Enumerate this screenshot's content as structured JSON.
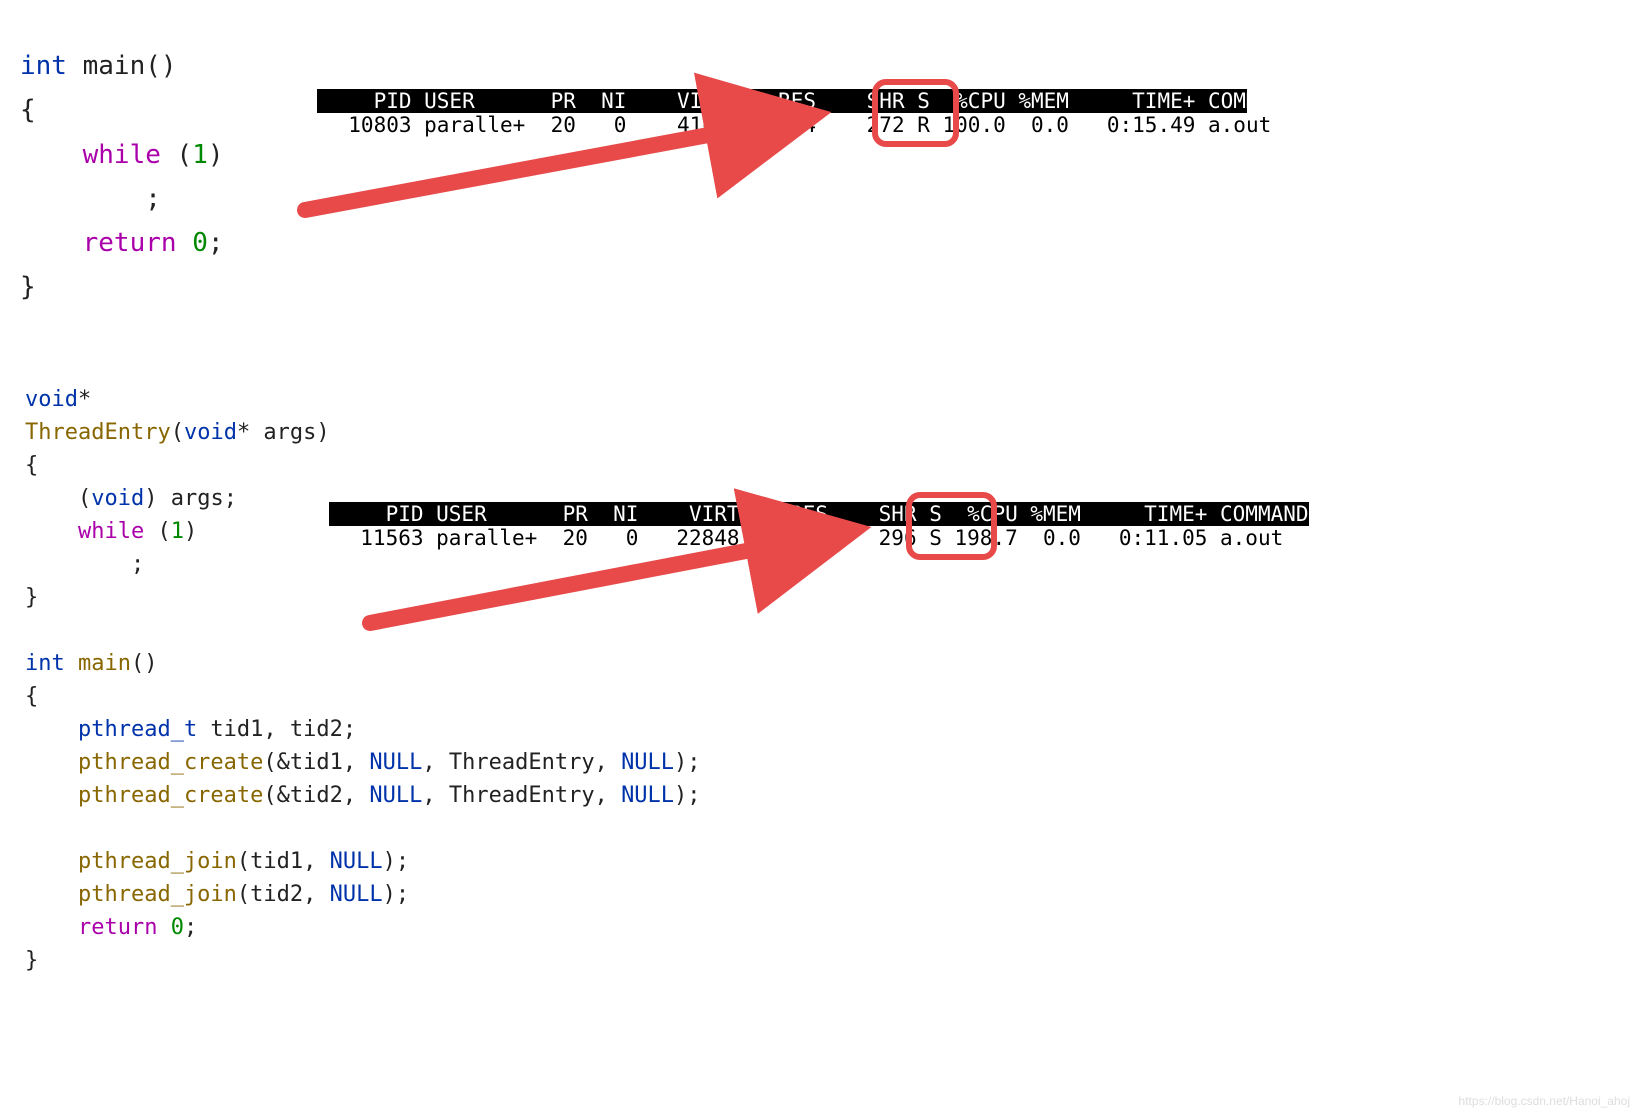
{
  "code1": {
    "l1a": "int",
    "l1b": " main()",
    "l2": "{",
    "l3a": "    while",
    "l3b": " (",
    "l3c": "1",
    "l3d": ")",
    "l4": "        ;",
    "l5a": "    return",
    "l5b": " ",
    "l5c": "0",
    "l5d": ";",
    "l6": "}"
  },
  "code2": {
    "l1a": "void",
    "l1b": "*",
    "l2a": "ThreadEntry",
    "l2b": "(",
    "l2c": "void",
    "l2d": "* args)",
    "l3": "{",
    "l4a": "    (",
    "l4b": "void",
    "l4c": ") args;",
    "l5a": "    while",
    "l5b": " (",
    "l5c": "1",
    "l5d": ")",
    "l6": "        ;",
    "l7": "}",
    "l8": "",
    "l9a": "int",
    "l9b": " ",
    "l9c": "main",
    "l9d": "()",
    "l10": "{",
    "l11a": "    pthread_t",
    "l11b": " tid1, tid2;",
    "l12a": "    pthread_create",
    "l12b": "(&tid1, ",
    "l12c": "NULL",
    "l12d": ", ThreadEntry, ",
    "l12e": "NULL",
    "l12f": ");",
    "l13a": "    pthread_create",
    "l13b": "(&tid2, ",
    "l13c": "NULL",
    "l13d": ", ThreadEntry, ",
    "l13e": "NULL",
    "l13f": ");",
    "l14": "",
    "l15a": "    pthread_join",
    "l15b": "(tid1, ",
    "l15c": "NULL",
    "l15d": ");",
    "l16a": "    pthread_join",
    "l16b": "(tid2, ",
    "l16c": "NULL",
    "l16d": ");",
    "l17a": "    return",
    "l17b": " ",
    "l17c": "0",
    "l17d": ";",
    "l18": "}"
  },
  "top1": {
    "header": "    PID USER      PR  NI    VIRT    RES    SHR S  %CPU %MEM     TIME+ COMMAND  ",
    "row": "  10803 paralle+  20   0    4164    344    272 R 100.0  0.0   0:15.49 a.out    ",
    "cpu": "100.0"
  },
  "top2": {
    "header": "    PID USER      PR  NI    VIRT    RES    SHR S  %CPU %MEM     TIME+ COMMAND  ",
    "row": "  11563 paralle+  20   0   22848    380    296 S 198.7  0.0   0:11.05 a.out    ",
    "cpu": "198.7"
  },
  "watermark": "https://blog.csdn.net/Hanoi_ahoj",
  "colors": {
    "highlight": "#e84a4a"
  }
}
